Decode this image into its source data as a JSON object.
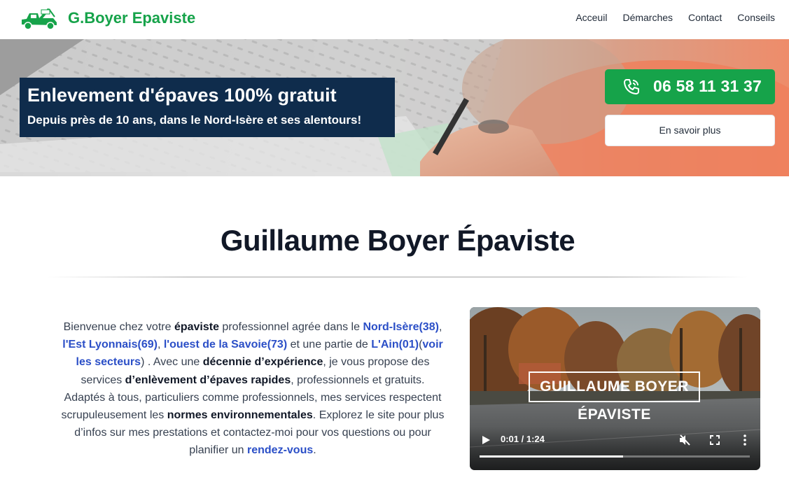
{
  "header": {
    "brand": "G.Boyer Epaviste",
    "nav": [
      "Acceuil",
      "Démarches",
      "Contact",
      "Conseils"
    ]
  },
  "hero": {
    "title": "Enlevement d'épaves 100% gratuit",
    "subtitle": "Depuis près de 10 ans, dans le Nord-Isère et ses alentours!",
    "phone": "06 58 11 31 37",
    "more_button": "En savoir plus"
  },
  "main": {
    "title": "Guillaume Boyer Épaviste",
    "intro": {
      "t1": "Bienvenue chez votre ",
      "b1": "épaviste",
      "t2": " professionnel agrée dans le ",
      "l1": "Nord-Isère(38)",
      "t3": ", ",
      "l2": "l'Est Lyonnais(69)",
      "t4": ", ",
      "l3": "l'ouest de la Savoie(73)",
      "t5": " et une partie de ",
      "l4": "L'Ain(01)",
      "t6": "(",
      "l5": "voir les secteurs",
      "t7": ") . Avec une ",
      "b2": "décennie d’expérience",
      "t8": ", je vous propose des services ",
      "b3": "d’enlèvement d’épaves rapides",
      "t9": ", professionnels et gratuits. Adaptés à tous, particuliers comme professionnels, mes services respectent scrupuleusement les ",
      "b4": "normes environnementales",
      "t10": ". Explorez le site pour plus d’infos sur mes prestations et contactez-moi pour vos questions ou pour planifier un ",
      "l6": "rendez-vous",
      "t11": "."
    }
  },
  "video": {
    "overlay_title": "GUILLAUME BOYER ÉPAVISTE",
    "time": "0:01 / 1:24",
    "progress": 0.53
  },
  "colors": {
    "brand_green": "#16a34a",
    "hero_box": "#0f2c4c",
    "link_blue": "#2b4fc7"
  },
  "icons": [
    "tow-truck-logo-icon",
    "phone-icon",
    "play-icon",
    "mute-icon",
    "fullscreen-icon",
    "more-vertical-icon"
  ]
}
